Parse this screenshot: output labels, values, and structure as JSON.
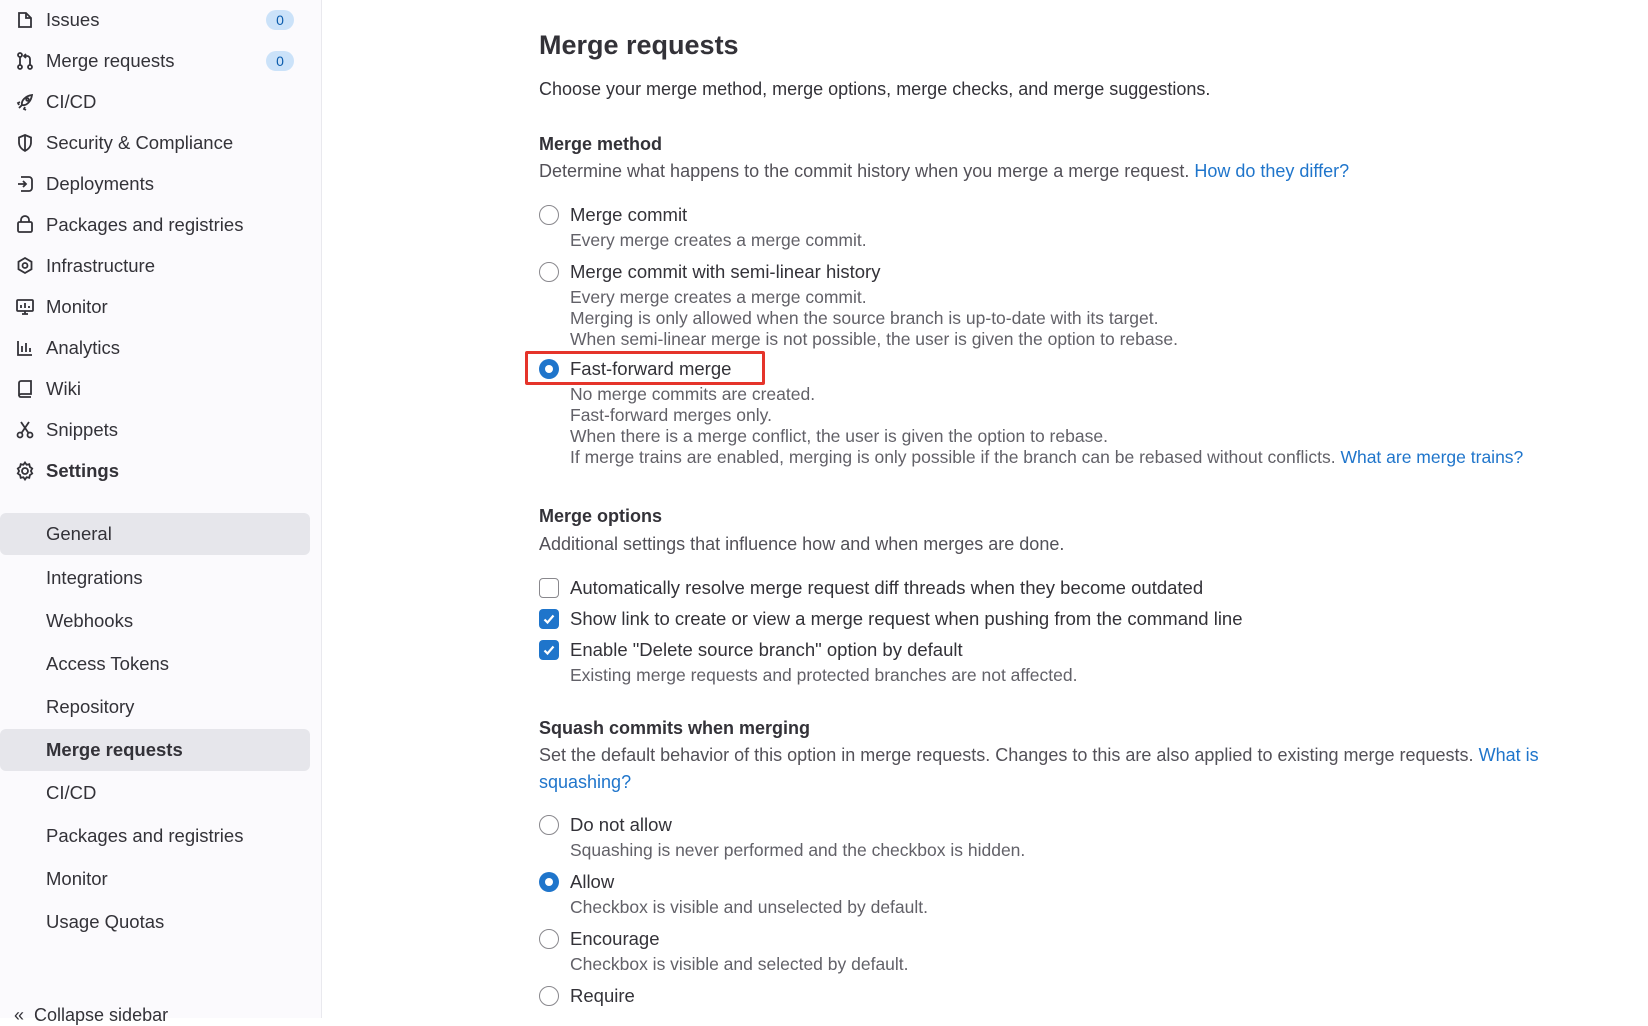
{
  "sidebar": {
    "items": [
      {
        "label": "Issues",
        "icon": "issues-icon",
        "badge": "0"
      },
      {
        "label": "Merge requests",
        "icon": "merge-request-icon",
        "badge": "0"
      },
      {
        "label": "CI/CD",
        "icon": "rocket-icon"
      },
      {
        "label": "Security & Compliance",
        "icon": "shield-icon"
      },
      {
        "label": "Deployments",
        "icon": "deployments-icon"
      },
      {
        "label": "Packages and registries",
        "icon": "package-icon"
      },
      {
        "label": "Infrastructure",
        "icon": "cloud-gear-icon"
      },
      {
        "label": "Monitor",
        "icon": "monitor-icon"
      },
      {
        "label": "Analytics",
        "icon": "chart-icon"
      },
      {
        "label": "Wiki",
        "icon": "book-icon"
      },
      {
        "label": "Snippets",
        "icon": "scissors-icon"
      },
      {
        "label": "Settings",
        "icon": "gear-icon"
      }
    ],
    "settings_sub": [
      {
        "label": "General"
      },
      {
        "label": "Integrations"
      },
      {
        "label": "Webhooks"
      },
      {
        "label": "Access Tokens"
      },
      {
        "label": "Repository"
      },
      {
        "label": "Merge requests"
      },
      {
        "label": "CI/CD"
      },
      {
        "label": "Packages and registries"
      },
      {
        "label": "Monitor"
      },
      {
        "label": "Usage Quotas"
      }
    ],
    "collapse_label": "Collapse sidebar"
  },
  "main": {
    "title": "Merge requests",
    "lead": "Choose your merge method, merge options, merge checks, and merge suggestions.",
    "merge_method": {
      "title": "Merge method",
      "desc": "Determine what happens to the commit history when you merge a merge request.",
      "link": "How do they differ?",
      "options": [
        {
          "label": "Merge commit",
          "help": [
            "Every merge creates a merge commit."
          ],
          "selected": false
        },
        {
          "label": "Merge commit with semi-linear history",
          "help": [
            "Every merge creates a merge commit.",
            "Merging is only allowed when the source branch is up-to-date with its target.",
            "When semi-linear merge is not possible, the user is given the option to rebase."
          ],
          "selected": false
        },
        {
          "label": "Fast-forward merge",
          "help": [
            "No merge commits are created.",
            "Fast-forward merges only.",
            "When there is a merge conflict, the user is given the option to rebase.",
            "If merge trains are enabled, merging is only possible if the branch can be rebased without conflicts."
          ],
          "help_link": "What are merge trains?",
          "selected": true
        }
      ]
    },
    "merge_options": {
      "title": "Merge options",
      "desc": "Additional settings that influence how and when merges are done.",
      "options": [
        {
          "label": "Automatically resolve merge request diff threads when they become outdated",
          "checked": false
        },
        {
          "label": "Show link to create or view a merge request when pushing from the command line",
          "checked": true
        },
        {
          "label": "Enable \"Delete source branch\" option by default",
          "checked": true,
          "help": "Existing merge requests and protected branches are not affected."
        }
      ]
    },
    "squash": {
      "title": "Squash commits when merging",
      "desc": "Set the default behavior of this option in merge requests. Changes to this are also applied to existing merge requests.",
      "link_part1": "What is",
      "link_part2": "squashing?",
      "options": [
        {
          "label": "Do not allow",
          "help": "Squashing is never performed and the checkbox is hidden.",
          "selected": false
        },
        {
          "label": "Allow",
          "help": "Checkbox is visible and unselected by default.",
          "selected": true
        },
        {
          "label": "Encourage",
          "help": "Checkbox is visible and selected by default.",
          "selected": false
        },
        {
          "label": "Require",
          "selected": false
        }
      ]
    }
  },
  "colors": {
    "accent": "#1f75cb",
    "focus": "#e5342a",
    "badge_bg": "#cbe2f9"
  }
}
